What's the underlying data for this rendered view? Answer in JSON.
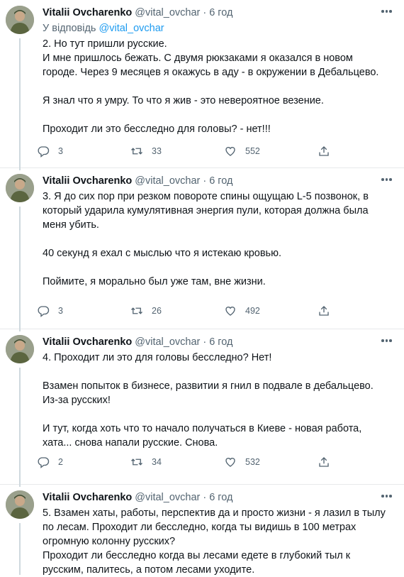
{
  "tweets": [
    {
      "name": "Vitalii Ovcharenko",
      "handle": "@vital_ovchar",
      "separator": "·",
      "time": "6 год",
      "reply_prefix": "У відповідь",
      "reply_handle": "@vital_ovchar",
      "lines": [
        "2. Но тут пришли русские.",
        "И мне пришлось бежать. С двумя рюкзаками я оказался в новом",
        "городе. Через 9 месяцев я окажусь в аду - в окружении в Дебальцево.",
        "",
        "Я знал что я умру. То что я жив - это невероятное везение.",
        "",
        "Проходит ли это бесследно для головы? - нет!!!"
      ],
      "replies": "3",
      "retweets": "33",
      "likes": "552"
    },
    {
      "name": "Vitalii Ovcharenko",
      "handle": "@vital_ovchar",
      "separator": "·",
      "time": "6 год",
      "lines": [
        "3. Я до сих пор при резком повороте спины ощущаю L-5 позвонок, в",
        "который ударила кумулятивная энергия пули, которая должна была",
        "меня убить.",
        "",
        "40 секунд я ехал с мыслью что я истекаю кровью.",
        "",
        "Поймите, я морально был уже там, вне жизни."
      ],
      "replies": "3",
      "retweets": "26",
      "likes": "492"
    },
    {
      "name": "Vitalii Ovcharenko",
      "handle": "@vital_ovchar",
      "separator": "·",
      "time": "6 год",
      "lines": [
        "4. Проходит ли это для головы бесследно? Нет!",
        "",
        "Взамен попыток в бизнесе, развитии я гнил в подвале в дебальцево.",
        "Из-за русских!",
        "",
        "И тут, когда хоть что то начало получаться в Киеве - новая работа,",
        "хата... снова напали русские. Снова."
      ],
      "replies": "2",
      "retweets": "34",
      "likes": "532"
    },
    {
      "name": "Vitalii Ovcharenko",
      "handle": "@vital_ovchar",
      "separator": "·",
      "time": "6 год",
      "lines": [
        "5. Взамен хаты, работы, перспектив да и просто жизни - я лазил в тылу",
        "по лесам. Проходит ли бесследно, когда ты видишь в 100 метрах",
        "огромную колонну русских?",
        "Проходит ли бесследно когда вы лесами едете в глубокий тыл к",
        "русским, палитесь, а потом лесами уходите."
      ]
    }
  ],
  "colors": {
    "accent": "#1d9bf0",
    "secondary_text": "#536471",
    "text": "#0f1419",
    "thread_line": "#cfd9de"
  }
}
